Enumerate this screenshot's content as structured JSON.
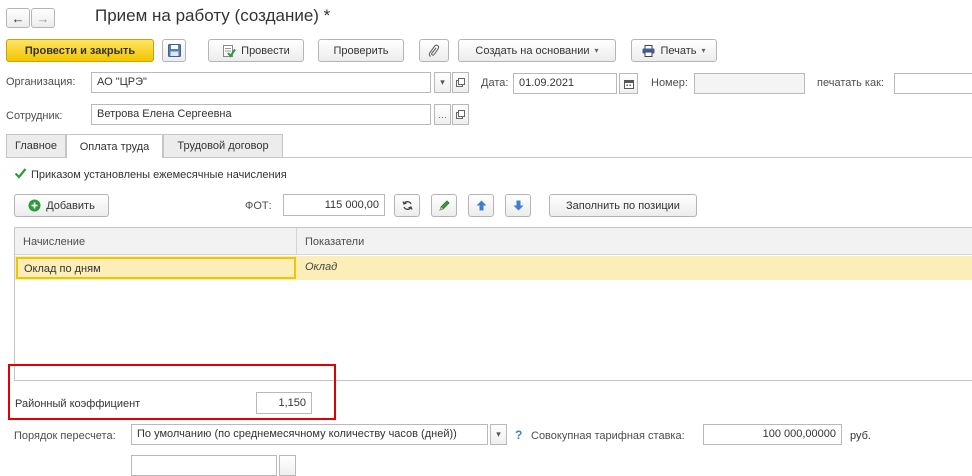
{
  "window": {
    "title": "Прием на работу (создание) *"
  },
  "nav": {
    "back_icon": "←",
    "forward_icon": "→"
  },
  "toolbar": {
    "post_and_close": "Провести и закрыть",
    "post": "Провести",
    "check": "Проверить",
    "create_based_on": "Создать на основании",
    "print": "Печать",
    "dropdown_caret": "▾"
  },
  "header": {
    "organization_label": "Организация:",
    "organization_value": "АО \"ЦРЭ\"",
    "date_label": "Дата:",
    "date_value": "01.09.2021",
    "number_label": "Номер:",
    "number_value": "",
    "print_as_label": "печатать как:",
    "employee_label": "Сотрудник:",
    "employee_value": "Ветрова Елена Сергеевна"
  },
  "tabs": [
    {
      "label": "Главное"
    },
    {
      "label": "Оплата труда"
    },
    {
      "label": "Трудовой договор"
    }
  ],
  "payment": {
    "monthly_accruals_label": "Приказом установлены ежемесячные начисления",
    "monthly_accruals_checked": true,
    "add_label": "Добавить",
    "fot_label": "ФОТ:",
    "fot_value": "115 000,00",
    "fill_by_position": "Заполнить по позиции",
    "table": {
      "headers": [
        "Начисление",
        "Показатели"
      ],
      "rows": [
        {
          "accrual": "Оклад по дням",
          "indicators": "Оклад"
        }
      ]
    },
    "regional_coef_label": "Районный коэффициент",
    "regional_coef_value": "1,150",
    "recalc_label": "Порядок пересчета:",
    "recalc_value": "По умолчанию (по среднемесячному количеству часов (дней))",
    "help_mark": "?",
    "total_rate_label": "Совокупная тарифная ставка:",
    "total_rate_value": "100 000,00000",
    "currency": "руб."
  },
  "colors": {
    "accent_yellow": "#f3c500",
    "highlight_red": "#e00000",
    "selected_row": "#fbeeb8",
    "check_green": "#2e9a3a"
  }
}
